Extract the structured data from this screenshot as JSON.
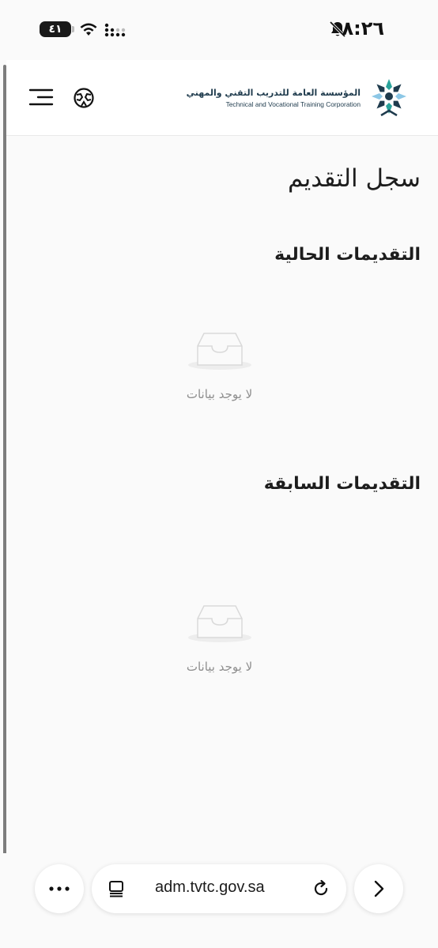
{
  "status_bar": {
    "time": "٨:٢٦",
    "battery": "٤١"
  },
  "header": {
    "logo_ar": "المؤسسة العامة للتدريب التقني والمهني",
    "logo_en": "Technical and Vocational Training Corporation",
    "menu_icon": "hamburger-menu-icon",
    "language_icon": "globe-icon"
  },
  "main": {
    "page_title": "سجل التقديم",
    "current_section": {
      "title": "التقديمات الحالية",
      "empty_text": "لا يوجد بيانات"
    },
    "previous_section": {
      "title": "التقديمات السابقة",
      "empty_text": "لا يوجد بيانات"
    }
  },
  "browser": {
    "url": "adm.tvtc.gov.sa",
    "more_icon": "ellipsis-icon",
    "reload_icon": "reload-icon",
    "forward_icon": "chevron-right-icon"
  },
  "colors": {
    "brand_dark": "#1f3b4d",
    "empty_text": "#8e8e8e",
    "background": "#fafafa"
  }
}
